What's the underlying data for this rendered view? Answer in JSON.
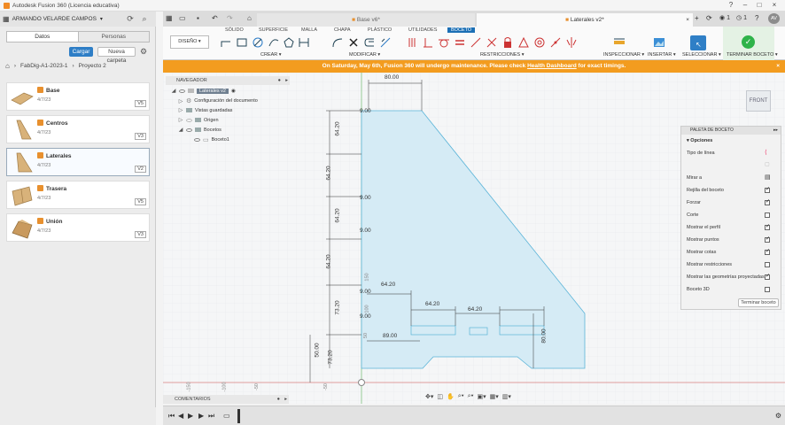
{
  "window": {
    "title": "Autodesk Fusion 360 (Licencia educativa)"
  },
  "user": {
    "name": "ARMANDO VELARDE CAMPOS"
  },
  "data_panel": {
    "tabs": [
      "Datos",
      "Personas"
    ],
    "upload_label": "Cargar",
    "new_folder_label": "Nueva carpeta",
    "breadcrumb": [
      "FabDig-A1-2023-1",
      "Proyecto 2"
    ],
    "items": [
      {
        "name": "Base",
        "date": "4/7/23",
        "version": "V5"
      },
      {
        "name": "Centros",
        "date": "4/7/23",
        "version": "V3"
      },
      {
        "name": "Laterales",
        "date": "4/7/23",
        "version": "V2"
      },
      {
        "name": "Trasera",
        "date": "4/7/23",
        "version": "V5"
      },
      {
        "name": "Unión",
        "date": "4/7/23",
        "version": "V3"
      }
    ]
  },
  "doc_tabs": [
    {
      "label": "Base v6*",
      "active": false
    },
    {
      "label": "Laterales v2*",
      "active": true
    }
  ],
  "doc_tab_counts": {
    "notifications": "1",
    "jobs": "1"
  },
  "avatar": "AV",
  "ribbon": {
    "tabs": [
      "SÓLIDO",
      "SUPERFICIE",
      "MALLA",
      "CHAPA",
      "PLÁSTICO",
      "UTILIDADES",
      "BOCETO"
    ],
    "workspace": "DISEÑO",
    "groups": [
      "CREAR",
      "MODIFICAR",
      "RESTRICCIONES",
      "INSPECCIONAR",
      "INSERTAR",
      "SELECCIONAR",
      "TERMINAR BOCETO"
    ]
  },
  "banner": {
    "text_before": "On Saturday, May 6th, Fusion 360 will undergo maintenance. Please check ",
    "link": "Health Dashboard",
    "text_after": " for exact timings."
  },
  "navigator": {
    "title": "NAVEGADOR",
    "root": "Laterales v2",
    "items": [
      "Configuración del documento",
      "Vistas guardadas",
      "Origen",
      "Bocetos",
      "Boceto1"
    ]
  },
  "palette": {
    "title": "PALETA DE BOCETO",
    "section": "Opciones",
    "rows": [
      {
        "label": "Tipo de línea",
        "checked": null
      },
      {
        "label": "Mirar a",
        "checked": null
      },
      {
        "label": "Rejilla del boceto",
        "checked": true
      },
      {
        "label": "Forzar",
        "checked": true
      },
      {
        "label": "Corte",
        "checked": false
      },
      {
        "label": "Mostrar el perfil",
        "checked": true
      },
      {
        "label": "Mostrar puntos",
        "checked": true
      },
      {
        "label": "Mostrar cotas",
        "checked": true
      },
      {
        "label": "Mostrar restricciones",
        "checked": false
      },
      {
        "label": "Mostrar las geometrías proyectadas",
        "checked": true
      },
      {
        "label": "Boceto 3D",
        "checked": false
      }
    ],
    "finish_label": "Terminar boceto"
  },
  "viewcube": {
    "label": "FRONT"
  },
  "comments": {
    "title": "COMENTARIOS"
  },
  "dimensions": [
    "80.00",
    "64.20",
    "64.20",
    "64.20",
    "64.20",
    "73.20",
    "73.20",
    "64.20",
    "64.20",
    "64.20",
    "89.00",
    "80.00",
    "50.00",
    "9.00",
    "9.00",
    "9.00",
    "9.00",
    "9.00"
  ],
  "axis_ticks": [
    "-150",
    "-100",
    "-50",
    "-50",
    "50",
    "100",
    "150"
  ],
  "colors": {
    "banner": "#f39c1f",
    "accent": "#1b6fb5",
    "profile": "#cfe8f3"
  }
}
